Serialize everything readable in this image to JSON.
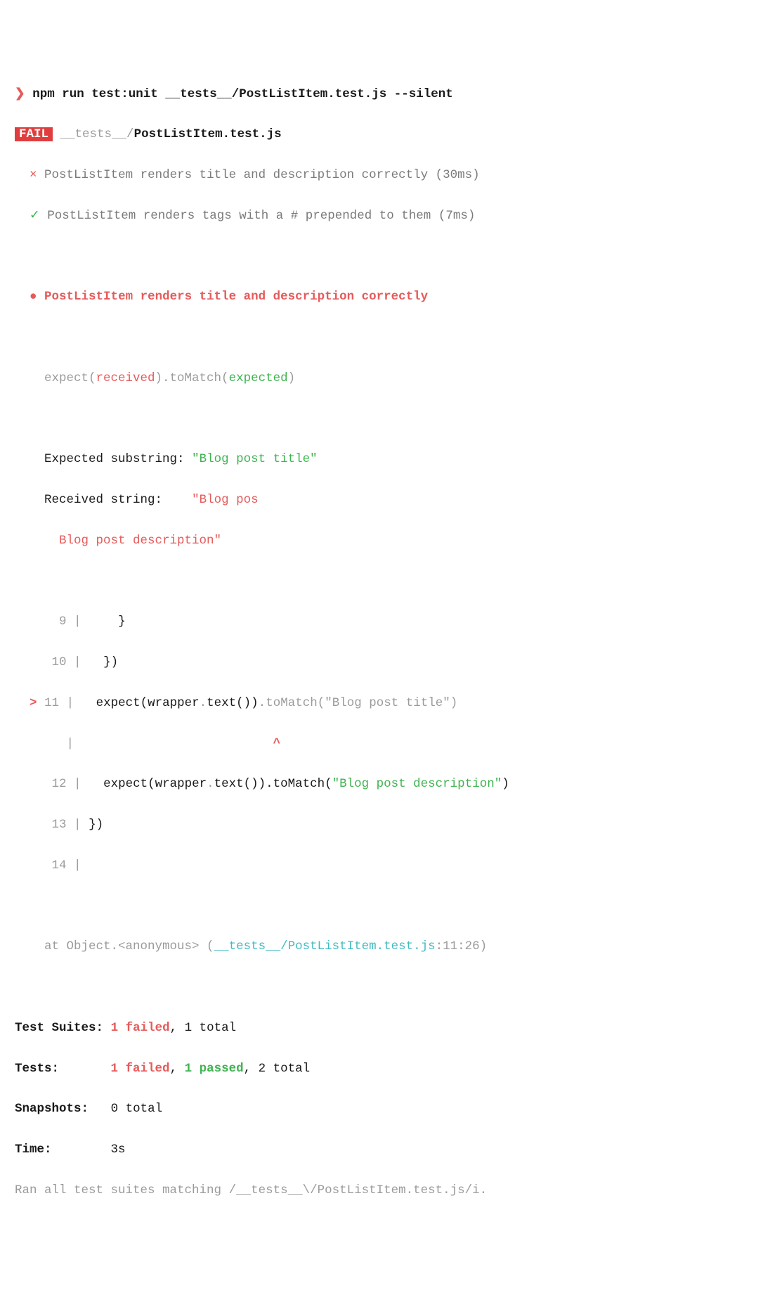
{
  "prompt": {
    "chevron": "❯",
    "cmd": "npm run test:unit __tests__/PostListItem.test.js --silent"
  },
  "badge": "FAIL",
  "file": {
    "path": "__tests__/",
    "name": "PostListItem.test.js"
  },
  "tests": {
    "fail_mark": "×",
    "pass_mark": "✓",
    "fail_name": "PostListItem renders title and description correctly",
    "fail_time": "(30ms)",
    "pass_name": "PostListItem renders tags with a # prepended to them",
    "pass_time": "(7ms)"
  },
  "focus": {
    "bullet": "●",
    "name": "PostListItem renders title and description correctly"
  },
  "assert": {
    "expect_l": "expect(",
    "received_tok": "received",
    "mid": ").toMatch(",
    "expected_tok": "expected",
    "close": ")"
  },
  "diff": {
    "exp_lbl": "Expected substring:",
    "exp_val": "\"Blog post title\"",
    "rec_lbl": "Received string:",
    "rec_val1": "\"Blog pos",
    "rec_val2": "Blog post description\""
  },
  "codeframe": {
    "l9n": "  9",
    "l9t": "    }",
    "l10n": " 10",
    "l10t": "  })",
    "ptr": ">",
    "l11n": "11",
    "l11_a": "  expect(wrapper",
    "dot": ".",
    "l11_b": "text())",
    "l11_c": "toMatch(",
    "l11_d": "\"Blog post title\"",
    "l11_e": ")",
    "caret": "^",
    "l12n": " 12",
    "l12_a": "  expect(wrapper",
    "l12_b": "text()).toMatch(",
    "l12_c": "\"Blog post description\"",
    "l12_d": ")",
    "l13n": " 13",
    "l13t": "})",
    "l14n": " 14"
  },
  "stack": {
    "pre": "at Object.<anonymous> (",
    "file": "__tests__/PostListItem.test.js",
    "post": ":11:26)"
  },
  "summary": {
    "suites_lbl": "Test Suites:",
    "one_failed": "1 failed",
    "comma": ", ",
    "suites_end": "1 total",
    "tests_lbl": "Tests:",
    "one_passed": "1 passed",
    "tests_end": "2 total",
    "snap_lbl": "Snapshots:",
    "snap_val": "0 total",
    "time_lbl": "Time:",
    "time_val": "3s",
    "ran_a": "Ran all test suites matching ",
    "ran_b": "/__tests__\\/PostListItem.test.js/i",
    "ran_c": "."
  }
}
